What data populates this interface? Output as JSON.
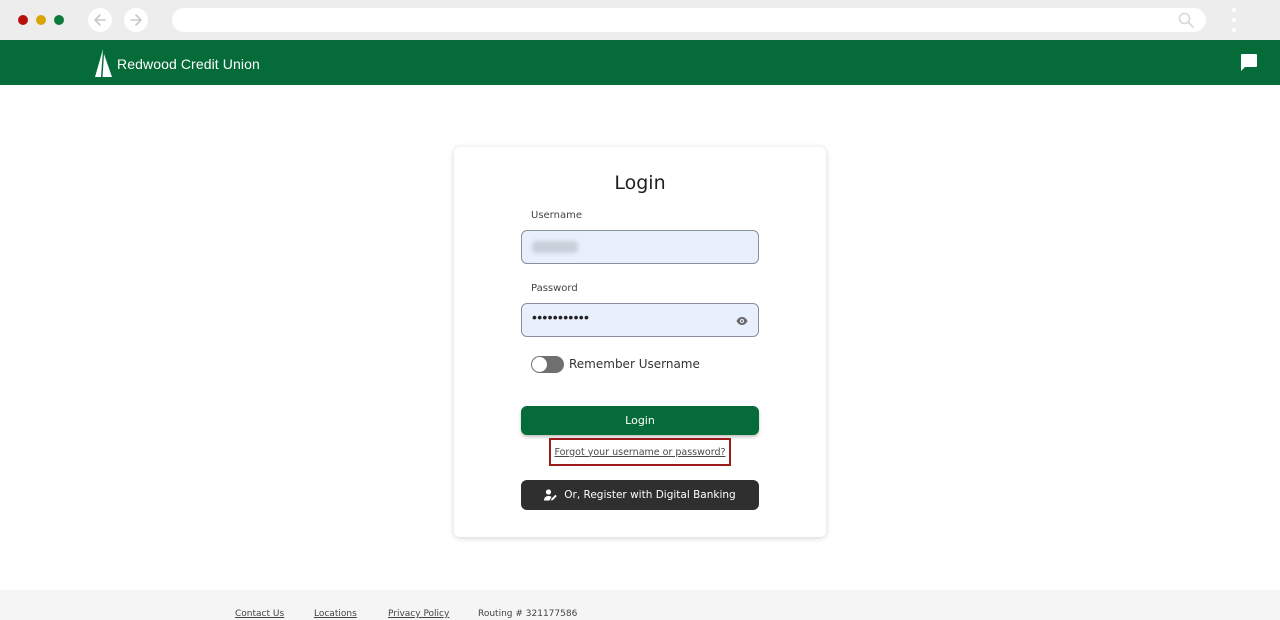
{
  "browser": {
    "window_controls": [
      "close",
      "minimize",
      "zoom"
    ],
    "icons": [
      "back-arrow-icon",
      "forward-arrow-icon",
      "search-icon",
      "kebab-menu-icon"
    ]
  },
  "header": {
    "brand_name": "Redwood Credit Union",
    "brand_color": "#056b38",
    "icons": [
      "tree-logo-icon",
      "chat-icon"
    ]
  },
  "login": {
    "title": "Login",
    "username_label": "Username",
    "password_label": "Password",
    "password_value": "•••••••••••",
    "remember_label": "Remember Username",
    "remember_enabled": false,
    "login_button": "Login",
    "forgot_link": "Forgot your username or password?",
    "register_button": "Or, Register with Digital Banking",
    "highlight_color": "#9c1b1b"
  },
  "footer": {
    "contact": "Contact Us",
    "locations": "Locations",
    "privacy": "Privacy Policy",
    "routing": "Routing # 321177586"
  }
}
